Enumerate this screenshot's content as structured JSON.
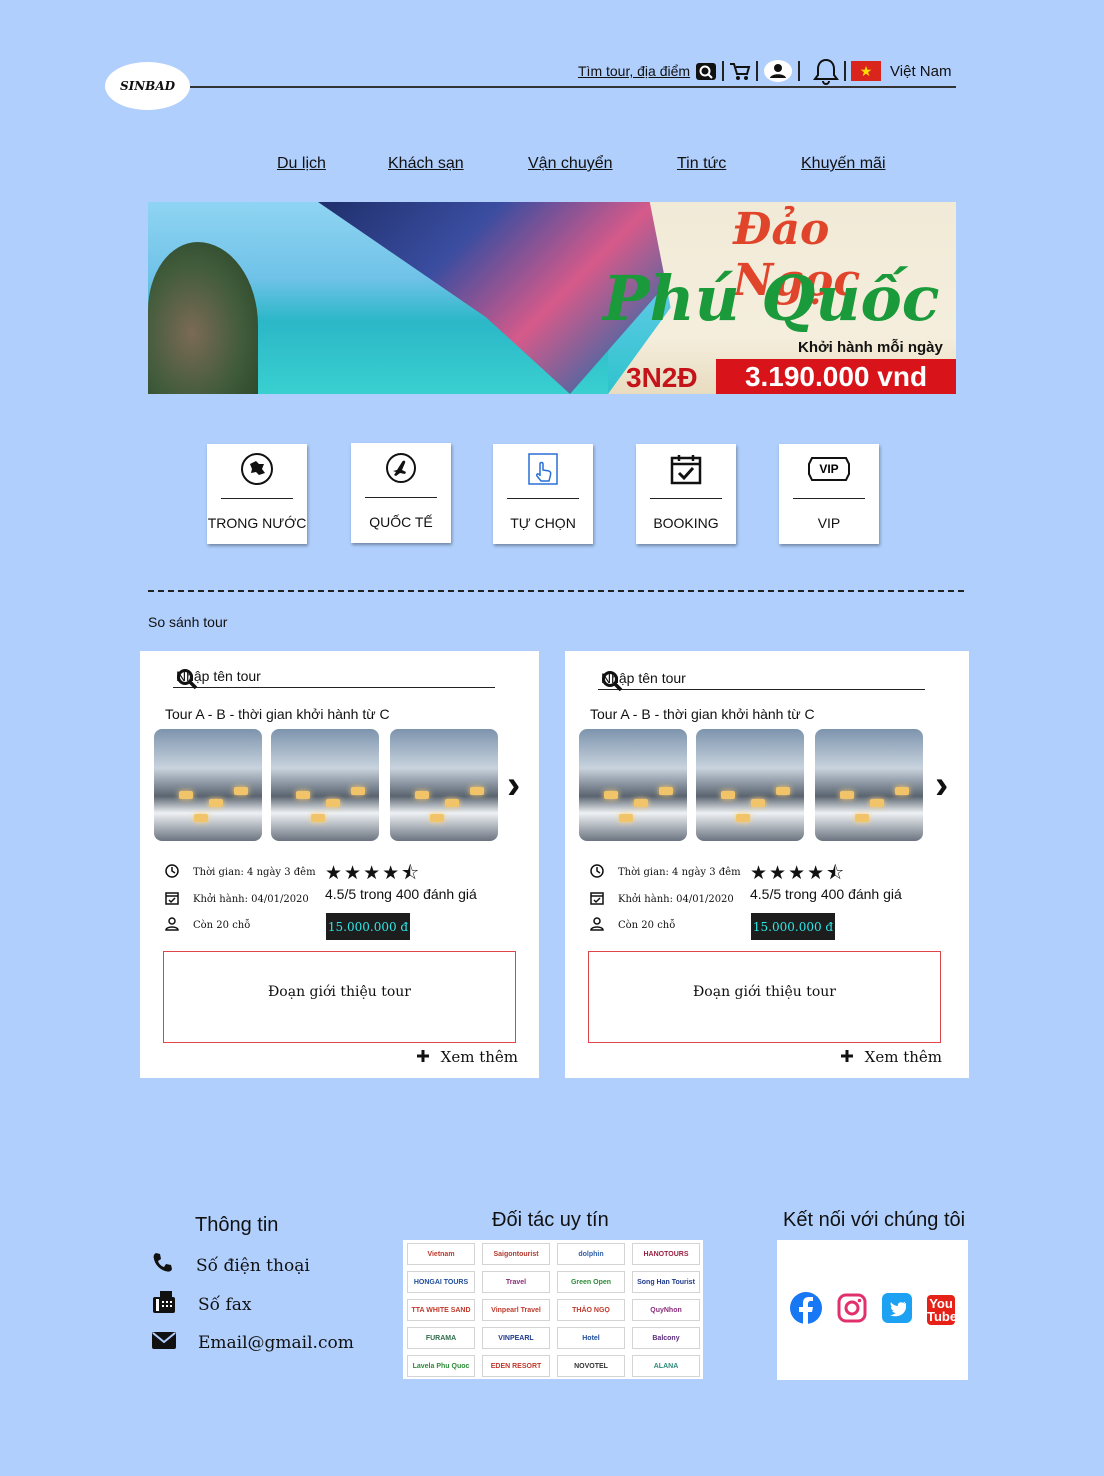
{
  "header": {
    "logo_text": "SINBAD",
    "search_label": "Tìm tour, địa điểm",
    "language": "Việt Nam"
  },
  "nav": [
    "Du lịch",
    "Khách sạn",
    "Vận chuyển",
    "Tin tức",
    "Khuyến mãi"
  ],
  "banner": {
    "title1": "Đảo Ngọc",
    "title2": "Phú Quốc",
    "subtitle": "Khởi hành mỗi ngày",
    "duration": "3N2Đ",
    "price": "3.190.000 vnd"
  },
  "categories": [
    {
      "label": "TRONG NƯỚC",
      "icon": "vietnam-map-icon"
    },
    {
      "label": "QUỐC TẾ",
      "icon": "airplane-icon"
    },
    {
      "label": "TỰ CHỌN",
      "icon": "touch-icon"
    },
    {
      "label": "BOOKING",
      "icon": "calendar-check-icon"
    },
    {
      "label": "VIP",
      "icon": "vip-ticket-icon"
    }
  ],
  "compare": {
    "title": "So sánh tour",
    "cards": [
      {
        "search_placeholder": "Nhập tên tour",
        "tour_name": "Tour A - B - thời gian khởi hành từ C",
        "duration": "Thời gian: 4 ngày 3 đêm",
        "departure": "Khởi hành: 04/01/2020",
        "seats": "Còn 20 chỗ",
        "stars": "★★★★⯪",
        "rating_value": 4.5,
        "rating": "4.5/5 trong 400 đánh giá",
        "price": "15.000.000 đ",
        "intro": "Đoạn giới thiệu tour",
        "more": "Xem thêm"
      },
      {
        "search_placeholder": "Nhập tên tour",
        "tour_name": "Tour A - B - thời gian khởi hành từ C",
        "duration": "Thời gian: 4 ngày 3 đêm",
        "departure": "Khởi hành: 04/01/2020",
        "seats": "Còn 20 chỗ",
        "stars": "★★★★⯪",
        "rating_value": 4.5,
        "rating": "4.5/5 trong 400 đánh giá",
        "price": "15.000.000 đ",
        "intro": "Đoạn giới thiệu tour",
        "more": "Xem thêm"
      }
    ]
  },
  "footer": {
    "info_title": "Thông tin",
    "phone": "Số điện thoại",
    "fax": "Số fax",
    "email": "Email@gmail.com",
    "partners_title": "Đối tác uy tín",
    "partners": [
      "Vietnam",
      "Saigontourist",
      "dolphin",
      "HANOTOURS",
      "HONGAI TOURS",
      "Travel",
      "Green Open",
      "Song Han Tourist",
      "TTA WHITE SAND",
      "Vinpearl Travel",
      "THẢO NGỌ",
      "QuyNhon",
      "FURAMA",
      "VINPEARL",
      "Hotel",
      "Balcony",
      "Lavela Phu Quoc",
      "EDEN RESORT",
      "NOVOTEL",
      "ALANA"
    ],
    "social_title": "Kết nối với chúng tôi",
    "youtube_text": "You Tube"
  },
  "colors": {
    "background": "#b0cffd",
    "price_text": "#2ee6e6",
    "banner_price_bg": "#d8141a",
    "intro_border": "#e0454a"
  }
}
